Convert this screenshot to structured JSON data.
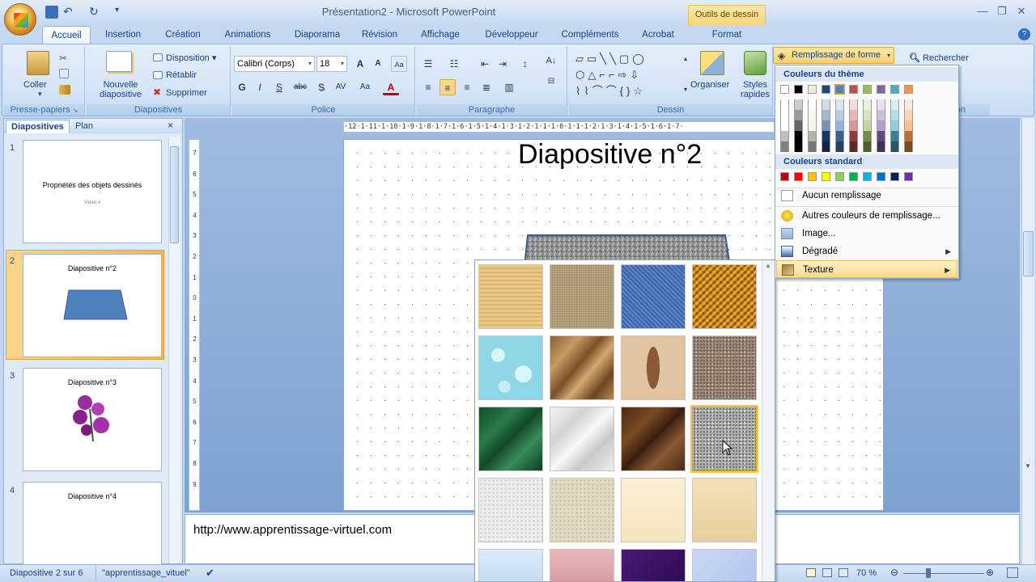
{
  "window": {
    "title": "Présentation2 - Microsoft PowerPoint",
    "contextual_header": "Outils de dessin"
  },
  "tabs": [
    "Accueil",
    "Insertion",
    "Création",
    "Animations",
    "Diaporama",
    "Révision",
    "Affichage",
    "Développeur",
    "Compléments",
    "Acrobat",
    "Format"
  ],
  "ribbon": {
    "clipboard": {
      "paste": "Coller",
      "label": "Presse-papiers"
    },
    "slides": {
      "new_slide": "Nouvelle diapositive",
      "layout": "Disposition",
      "reset": "Rétablir",
      "delete": "Supprimer",
      "label": "Diapositives"
    },
    "font": {
      "name": "Calibri (Corps)",
      "size": "18",
      "label": "Police"
    },
    "paragraph": {
      "label": "Paragraphe"
    },
    "drawing": {
      "arrange": "Organiser",
      "quick_styles": "Styles rapides",
      "label": "Dessin"
    },
    "editing": {
      "find": "Rechercher",
      "label_partial": "ion"
    }
  },
  "panel": {
    "tabs": [
      "Diapositives",
      "Plan"
    ],
    "close": "×",
    "slides": [
      {
        "num": "1",
        "title": "Propriétés des objets dessinés",
        "subtitle": "Vidéo 4"
      },
      {
        "num": "2",
        "title": "Diapositive  n°2"
      },
      {
        "num": "3",
        "title": "Diapositive  n°3"
      },
      {
        "num": "4",
        "title": "Diapositive  n°4"
      }
    ]
  },
  "slide": {
    "title": "Diapositive n°2"
  },
  "notes": {
    "text": "http://www.apprentissage-virtuel.com"
  },
  "fill_menu": {
    "button": "Remplissage de forme",
    "theme_colors_header": "Couleurs du thème",
    "standard_colors_header": "Couleurs standard",
    "no_fill": "Aucun remplissage",
    "more_colors": "Autres couleurs de remplissage...",
    "picture": "Image...",
    "gradient": "Dégradé",
    "texture": "Texture",
    "theme_colors": [
      "#ffffff",
      "#000000",
      "#eeece1",
      "#1f497d",
      "#4f81bd",
      "#c0504d",
      "#9bbb59",
      "#8064a2",
      "#4bacc6",
      "#f79646"
    ],
    "standard_colors": [
      "#c00000",
      "#ff0000",
      "#ffc000",
      "#ffff00",
      "#92d050",
      "#00b050",
      "#00b0f0",
      "#0070c0",
      "#002060",
      "#7030a0"
    ]
  },
  "status": {
    "slide_info": "Diapositive 2 sur 6",
    "theme": "\"apprentissage_vituel\"",
    "zoom": "70 %"
  },
  "ruler": {
    "h": "·12·1·11·1·10·1·9·1·8·1·7·1·6·1·5·1·4·1·3·1·2·1·1·1·0·1·1·1·2·1·3·1·4·1·5·1·6·1·7·",
    "v": [
      "7",
      "6",
      "5",
      "4",
      "3",
      "2",
      "1",
      "0",
      "1",
      "2",
      "3",
      "4",
      "5",
      "6",
      "7",
      "8",
      "9"
    ]
  }
}
